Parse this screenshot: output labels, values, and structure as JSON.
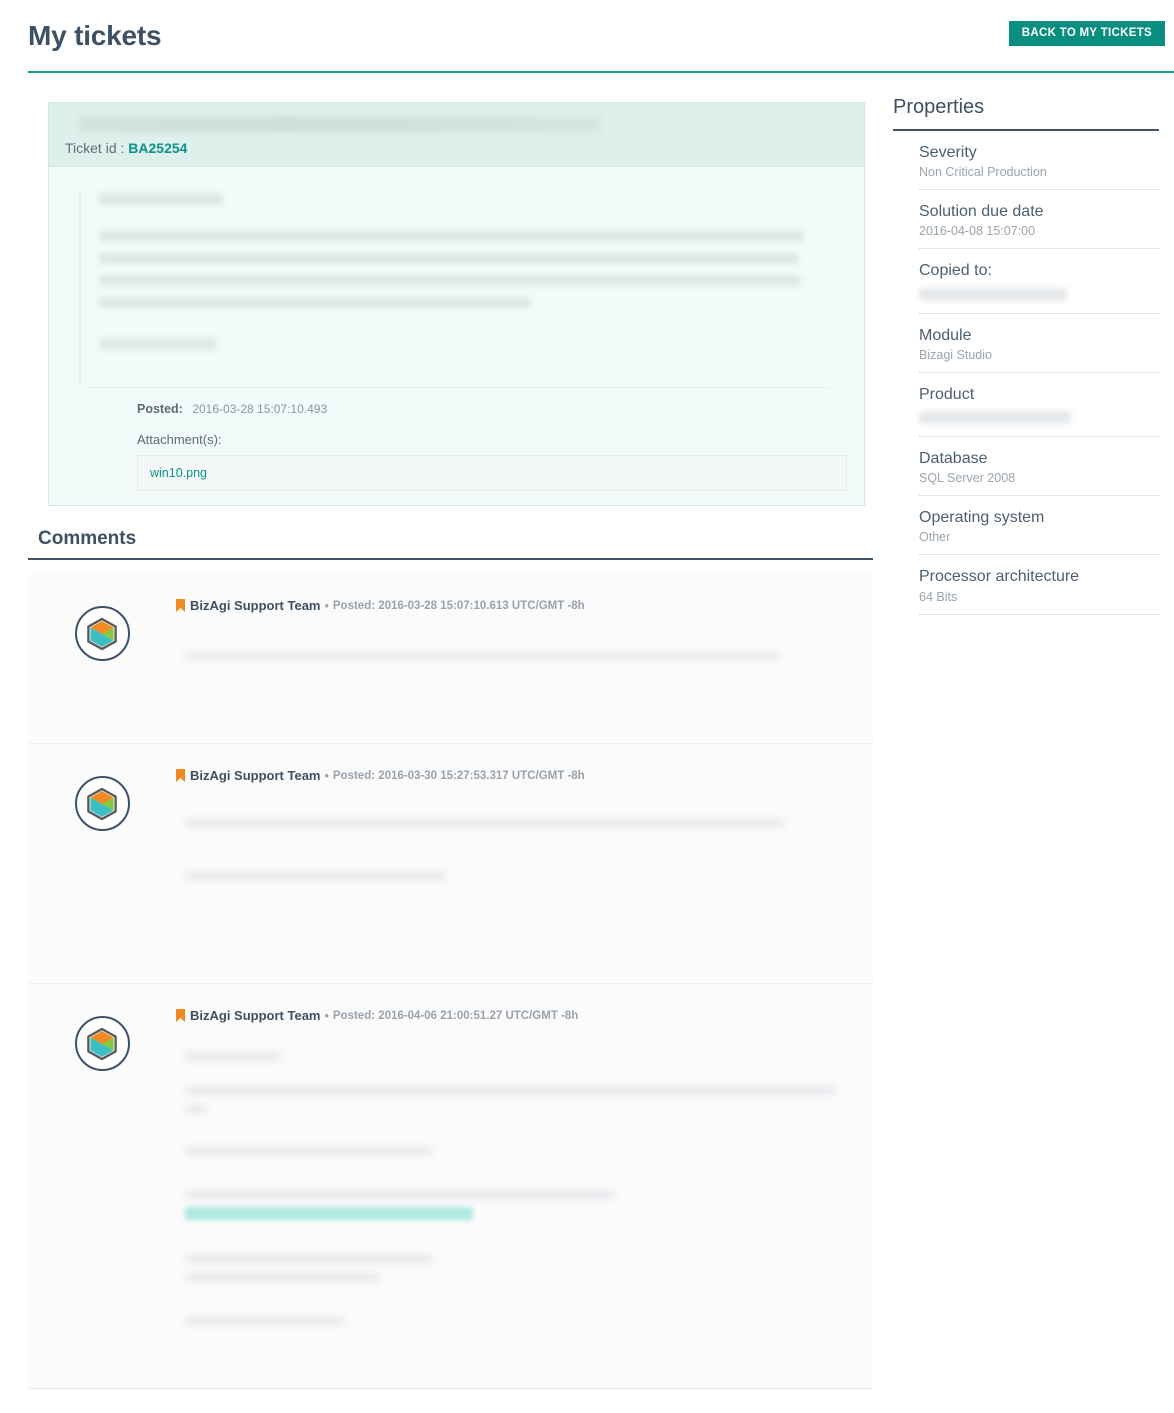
{
  "header": {
    "title": "My tickets",
    "back_button_label": "BACK TO MY TICKETS"
  },
  "ticket": {
    "title_redacted": true,
    "ticket_id_label": "Ticket id :",
    "ticket_id_value": "BA25254",
    "description_redacted": true,
    "posted_label": "Posted:",
    "posted_value": "2016-03-28 15:07:10.493",
    "attachments_label": "Attachment(s):",
    "attachments": [
      {
        "name": "win10.png"
      }
    ]
  },
  "comments_section": {
    "heading": "Comments",
    "comments": [
      {
        "author": "BizAgi Support Team",
        "separator": "•",
        "posted": "Posted: 2016-03-28 15:07:10.613 UTC/GMT -8h",
        "body_redacted": true,
        "avatar_icon": "bizagi-hexagon-logo",
        "flag_icon": "bookmark-icon"
      },
      {
        "author": "BizAgi Support Team",
        "separator": "•",
        "posted": "Posted: 2016-03-30 15:27:53.317 UTC/GMT -8h",
        "body_redacted": true,
        "avatar_icon": "bizagi-hexagon-logo",
        "flag_icon": "bookmark-icon"
      },
      {
        "author": "BizAgi Support Team",
        "separator": "•",
        "posted": "Posted: 2016-04-06 21:00:51.27 UTC/GMT -8h",
        "body_redacted": true,
        "has_highlighted_link": true,
        "avatar_icon": "bizagi-hexagon-logo",
        "flag_icon": "bookmark-icon"
      }
    ]
  },
  "properties": {
    "title": "Properties",
    "rows": [
      {
        "label": "Severity",
        "value": "Non Critical Production",
        "redacted": false
      },
      {
        "label": "Solution due date",
        "value": "2016-04-08 15:07:00",
        "redacted": false
      },
      {
        "label": "Copied to:",
        "value": "",
        "redacted": true
      },
      {
        "label": "Module",
        "value": "Bizagi Studio",
        "redacted": false
      },
      {
        "label": "Product",
        "value": "",
        "redacted": true
      },
      {
        "label": "Database",
        "value": "SQL Server 2008",
        "redacted": false
      },
      {
        "label": "Operating system",
        "value": "Other",
        "redacted": false
      },
      {
        "label": "Processor architecture",
        "value": "64 Bits",
        "redacted": false
      }
    ]
  },
  "colors": {
    "accent_teal": "#0c9a93",
    "button_green": "#0a8e80",
    "card_header_mint": "#ddf0ec",
    "card_body_mint": "#f2fbf9",
    "heading_navy": "#3e5063",
    "rule_navy": "#3f5369",
    "link_teal": "#0b9389",
    "flag_orange": "#f08a24",
    "logo_orange": "#f08a24",
    "logo_green": "#8cc63e",
    "logo_teal": "#3ac0c4",
    "avatar_ring": "#3d5168"
  }
}
